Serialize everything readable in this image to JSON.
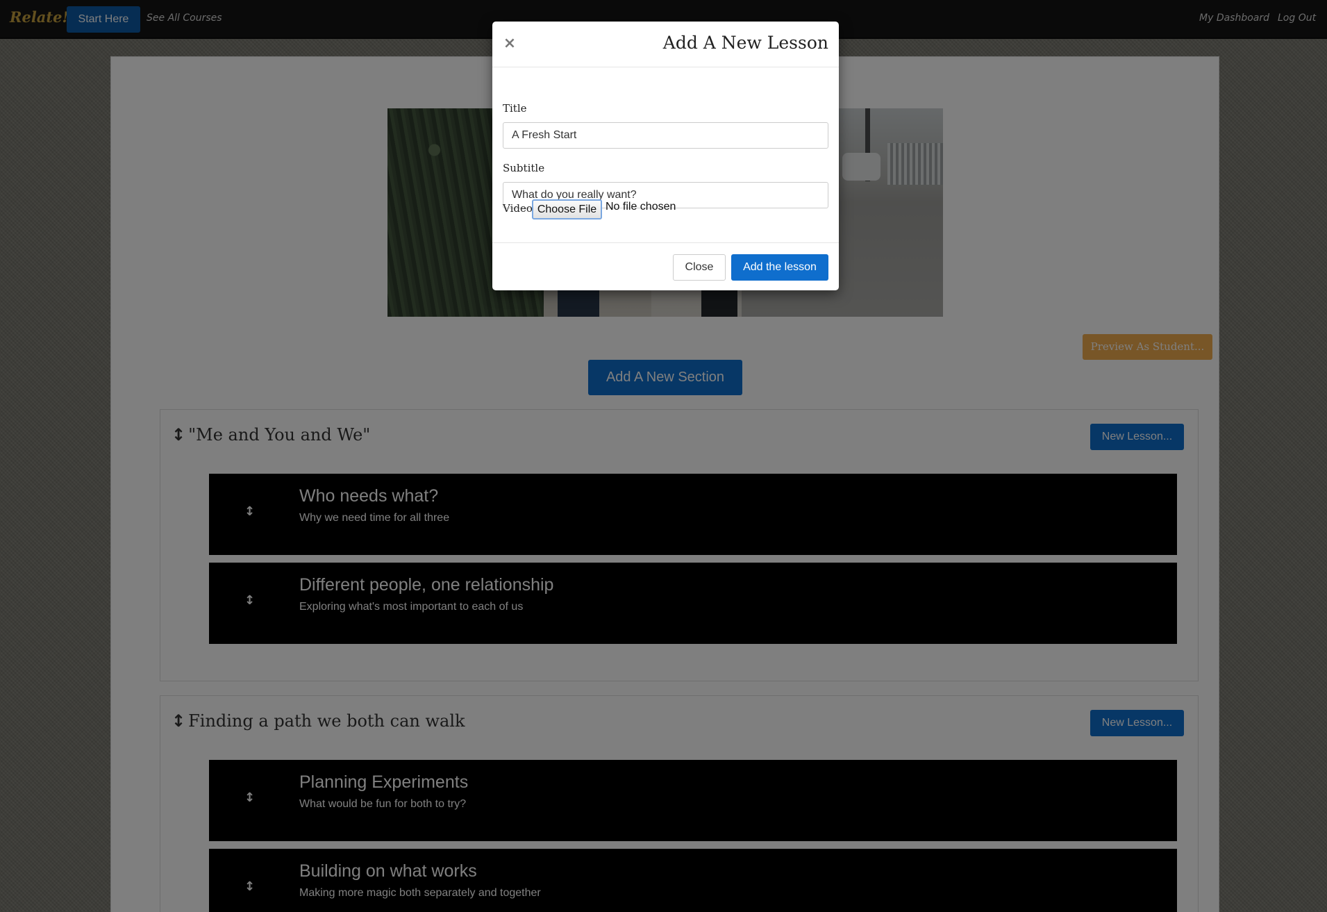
{
  "navbar": {
    "brand": "Relate!",
    "start_here": "Start Here",
    "see_all_courses": "See All Courses",
    "my_dashboard": "My Dashboard",
    "log_out": "Log Out"
  },
  "course": {
    "preview_button": "Preview As Student...",
    "add_section_button": "Add A New Section",
    "sections": [
      {
        "title": "\"Me and You and We\"",
        "new_lesson_button": "New Lesson...",
        "lessons": [
          {
            "title": "Who needs what?",
            "subtitle": "Why we need time for all three"
          },
          {
            "title": "Different people, one relationship",
            "subtitle": "Exploring what's most important to each of us"
          }
        ]
      },
      {
        "title": "Finding a path we both can walk",
        "new_lesson_button": "New Lesson...",
        "lessons": [
          {
            "title": "Planning Experiments",
            "subtitle": "What would be fun for both to try?"
          },
          {
            "title": "Building on what works",
            "subtitle": "Making more magic both separately and together"
          }
        ]
      }
    ]
  },
  "modal": {
    "close_icon": "×",
    "title": "Add A New Lesson",
    "fields": {
      "title_label": "Title",
      "title_value": "A Fresh Start",
      "subtitle_label": "Subtitle",
      "subtitle_value": "What do you really want?",
      "video_label": "Video",
      "file_button": "Choose File",
      "file_status": "No file chosen"
    },
    "close_button": "Close",
    "submit_button": "Add the lesson"
  },
  "icons": {
    "drag_handle": "↕",
    "close": "×"
  },
  "colors": {
    "primary": "#0f6ecd",
    "brand": "#c7a13e",
    "warning": "#f0ad4e",
    "navbar": "#141414",
    "lesson_card": "#000000"
  }
}
